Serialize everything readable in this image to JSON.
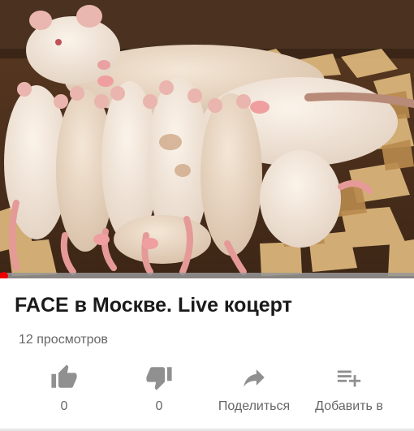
{
  "video": {
    "thumbnail": "rat-litter-photo",
    "progress_percent": 1
  },
  "title": "FACE в Москве. Live коцерт",
  "views": "12 просмотров",
  "actions": [
    {
      "icon": "thumbs-up-icon",
      "label": "0"
    },
    {
      "icon": "thumbs-down-icon",
      "label": "0"
    },
    {
      "icon": "share-icon",
      "label": "Поделиться"
    },
    {
      "icon": "add-to-playlist-icon",
      "label": "Добавить в"
    }
  ],
  "colors": {
    "accent": "#ee0000",
    "text": "#1a1a1a",
    "muted": "#666666",
    "icon": "#909090"
  }
}
